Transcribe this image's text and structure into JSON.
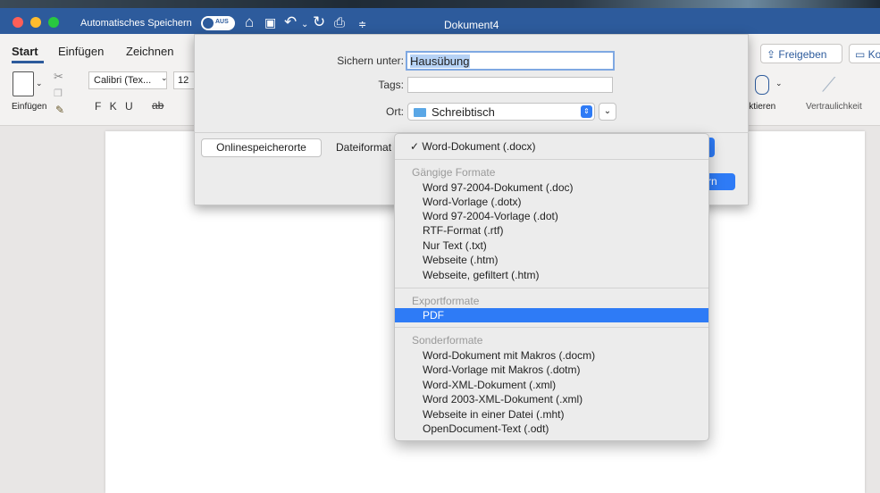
{
  "titlebar": {
    "autosave_label": "Automatisches Speichern",
    "autosave_toggle": "AUS",
    "document_title": "Dokument4",
    "icons": [
      "home-icon",
      "save-icon",
      "undo-icon",
      "redo-icon",
      "print-icon",
      "customize-icon"
    ]
  },
  "ribbon": {
    "tabs": [
      "Start",
      "Einfügen",
      "Zeichnen"
    ],
    "paste_label": "Einfügen",
    "font_name": "Calibri (Tex...",
    "font_size": "12",
    "format_row": "F K U",
    "share_label": "Freigeben",
    "comments_label": "Ko",
    "dictate_label": "iktieren",
    "sensitivity_label": "Vertraulichkeit"
  },
  "save_sheet": {
    "save_as_label": "Sichern unter:",
    "save_as_value": "Hausübung",
    "tags_label": "Tags:",
    "tags_value": "",
    "location_label": "Ort:",
    "location_value": "Schreibtisch",
    "online_locations_button": "Onlinespeicherorte",
    "file_format_label": "Dateiformat",
    "save_button_partial": "rn"
  },
  "format_menu": {
    "selected": "Word-Dokument (.docx)",
    "groups": [
      {
        "header": "Gängige Formate",
        "items": [
          "Word 97-2004-Dokument (.doc)",
          "Word-Vorlage (.dotx)",
          "Word 97-2004-Vorlage (.dot)",
          "RTF-Format (.rtf)",
          "Nur Text (.txt)",
          "Webseite (.htm)",
          "Webseite, gefiltert (.htm)"
        ]
      },
      {
        "header": "Exportformate",
        "items": [
          "PDF"
        ]
      },
      {
        "header": "Sonderformate",
        "items": [
          "Word-Dokument mit Makros (.docm)",
          "Word-Vorlage mit Makros (.dotm)",
          "Word-XML-Dokument (.xml)",
          "Word 2003-XML-Dokument (.xml)",
          "Webseite in einer Datei (.mht)",
          "OpenDocument-Text (.odt)"
        ]
      }
    ],
    "highlighted": "PDF"
  },
  "colors": {
    "titlebar": "#2d5b9c",
    "accent": "#2e7bf6",
    "traffic_red": "#ff5f57",
    "traffic_yellow": "#febc2e",
    "traffic_green": "#28c840"
  }
}
